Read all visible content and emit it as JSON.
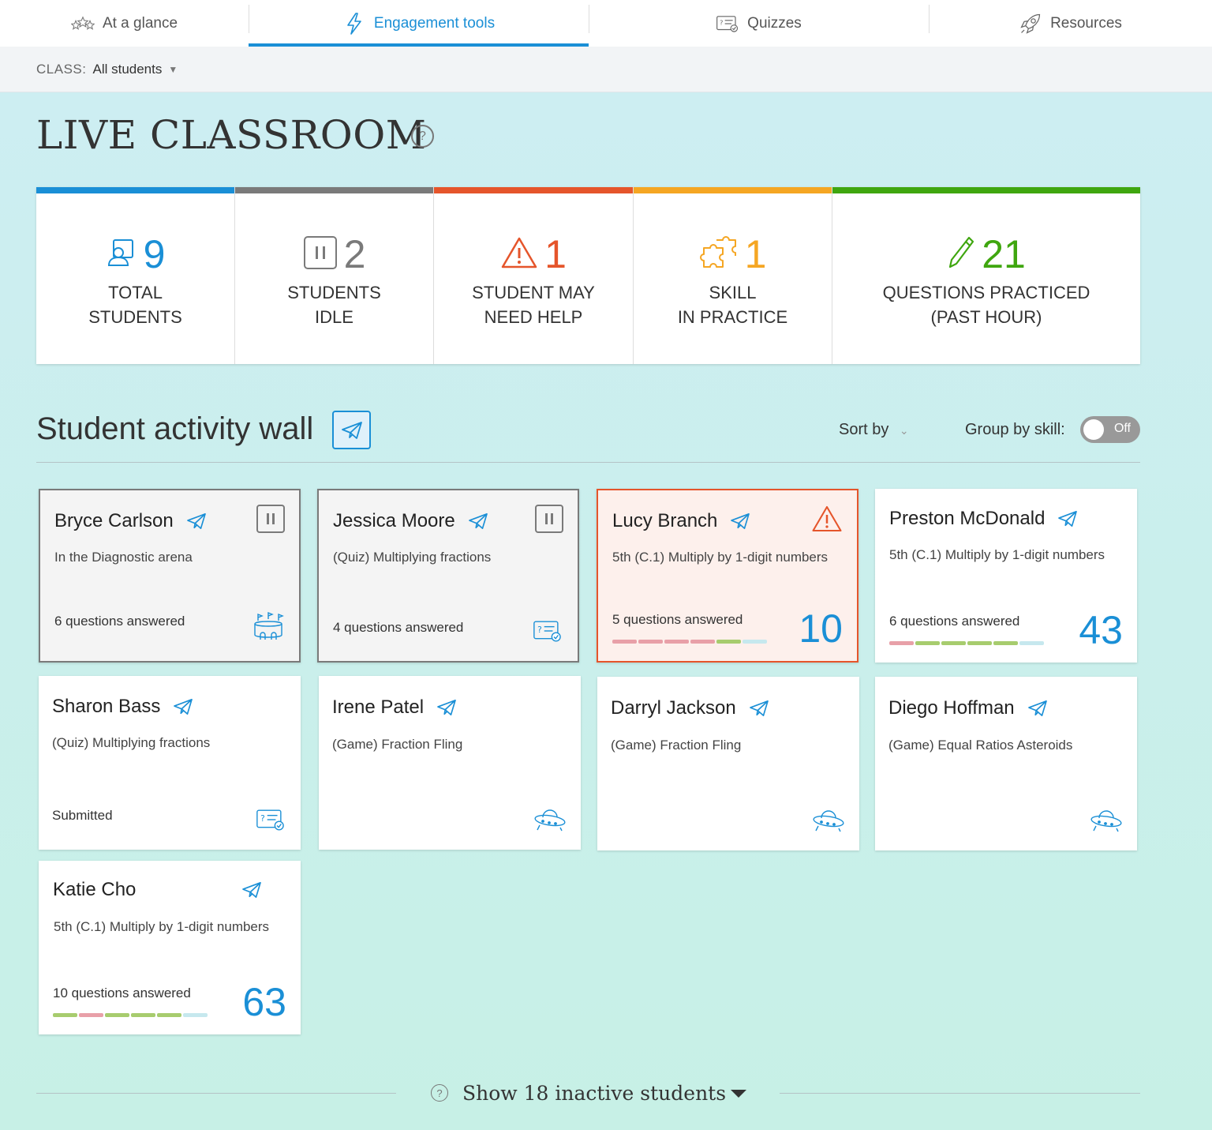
{
  "nav": {
    "tabs": [
      {
        "label": "At a glance",
        "icon": "stars-icon"
      },
      {
        "label": "Engagement tools",
        "icon": "lightning-icon",
        "active": true
      },
      {
        "label": "Quizzes",
        "icon": "quiz-icon"
      },
      {
        "label": "Resources",
        "icon": "rocket-icon"
      }
    ]
  },
  "classbar": {
    "label": "CLASS:",
    "value": "All students"
  },
  "title": "LIVE CLASSROOM",
  "stats": [
    {
      "value": "9",
      "label1": "TOTAL",
      "label2": "STUDENTS",
      "color": "#1a8fd6",
      "icon": "students-icon"
    },
    {
      "value": "2",
      "label1": "STUDENTS",
      "label2": "IDLE",
      "color": "#7a7a7a",
      "icon": "pause-icon"
    },
    {
      "value": "1",
      "label1": "STUDENT MAY",
      "label2": "NEED HELP",
      "color": "#e5552b",
      "icon": "warning-icon"
    },
    {
      "value": "1",
      "label1": "SKILL",
      "label2": "IN PRACTICE",
      "color": "#f5a623",
      "icon": "puzzle-icon"
    },
    {
      "value": "21",
      "label1": "QUESTIONS PRACTICED",
      "label2": "(PAST HOUR)",
      "color": "#3fa60f",
      "icon": "pencil-icon"
    }
  ],
  "wall": {
    "title": "Student activity wall",
    "sort_label": "Sort by",
    "group_label": "Group by skill:",
    "toggle_label": "Off"
  },
  "students": [
    {
      "name": "Bryce Carlson",
      "activity": "In the Diagnostic arena",
      "footer": "6 questions answered",
      "state": "idle",
      "icon": "arena-icon"
    },
    {
      "name": "Jessica Moore",
      "activity": "(Quiz) Multiplying fractions",
      "footer": "4 questions answered",
      "state": "idle",
      "icon": "quiz-icon"
    },
    {
      "name": "Lucy Branch",
      "activity": "5th (C.1)  Multiply by 1-digit numbers",
      "footer": "5 questions answered",
      "score": "10",
      "state": "help"
    },
    {
      "name": "Preston McDonald",
      "activity": "5th (C.1)  Multiply by 1-digit numbers",
      "footer": "6 questions answered",
      "score": "43",
      "state": "normal"
    },
    {
      "name": "Sharon Bass",
      "activity": "(Quiz) Multiplying fractions",
      "footer": "Submitted",
      "state": "normal",
      "icon": "quiz-icon"
    },
    {
      "name": "Irene Patel",
      "activity": "(Game) Fraction Fling",
      "footer": "",
      "state": "normal",
      "icon": "ufo-icon"
    },
    {
      "name": "Darryl Jackson",
      "activity": "(Game) Fraction Fling",
      "footer": "",
      "state": "normal",
      "icon": "ufo-icon"
    },
    {
      "name": "Diego Hoffman",
      "activity": "(Game) Equal Ratios Asteroids",
      "footer": "",
      "state": "normal",
      "icon": "ufo-icon"
    },
    {
      "name": "Katie Cho",
      "activity": "5th (C.1)  Multiply by 1-digit numbers",
      "footer": "10 questions answered",
      "score": "63",
      "state": "normal"
    }
  ],
  "inactive_label": "Show 18 inactive students"
}
